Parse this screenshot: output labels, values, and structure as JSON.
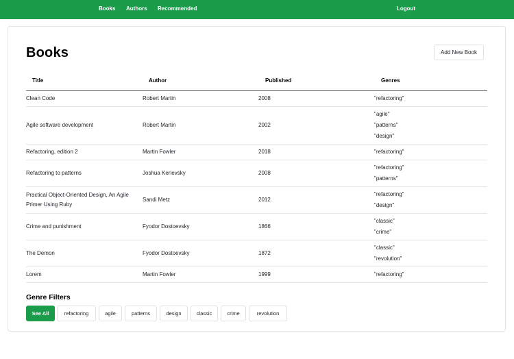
{
  "nav": {
    "books": "Books",
    "authors": "Authors",
    "recommended": "Recommended",
    "logout": "Logout"
  },
  "page": {
    "title": "Books",
    "add_button": "Add New Book"
  },
  "table": {
    "headers": {
      "title": "Title",
      "author": "Author",
      "published": "Published",
      "genres": "Genres"
    },
    "rows": [
      {
        "title": "Clean Code",
        "author": "Robert Martin",
        "published": "2008",
        "genres": [
          "\"refactoring\""
        ]
      },
      {
        "title": "Agile software development",
        "author": "Robert Martin",
        "published": "2002",
        "genres": [
          "\"agile\"",
          "\"patterns\"",
          "\"design\""
        ]
      },
      {
        "title": "Refactoring, edition 2",
        "author": "Martin Fowler",
        "published": "2018",
        "genres": [
          "\"refactoring\""
        ]
      },
      {
        "title": "Refactoring to patterns",
        "author": "Joshua Kerievsky",
        "published": "2008",
        "genres": [
          "\"refactoring\"",
          "\"patterns\""
        ]
      },
      {
        "title": "Practical Object-Oriented Design, An Agile Primer Using Ruby",
        "author": "Sandi Metz",
        "published": "2012",
        "genres": [
          "\"refactoring\"",
          "\"design\""
        ]
      },
      {
        "title": "Crime and punishment",
        "author": "Fyodor Dostoevsky",
        "published": "1866",
        "genres": [
          "\"classic\"",
          "\"crime\""
        ]
      },
      {
        "title": "The Demon",
        "author": "Fyodor Dostoevsky",
        "published": "1872",
        "genres": [
          "\"classic\"",
          "\"revolution\""
        ]
      },
      {
        "title": "Lorem",
        "author": "Martin Fowler",
        "published": "1999",
        "genres": [
          "\"refactoring\""
        ]
      }
    ]
  },
  "filters": {
    "title": "Genre Filters",
    "selected": "See All",
    "items": [
      "See All",
      "refactoring",
      "agile",
      "patterns",
      "design",
      "classic",
      "crime",
      "revolution"
    ]
  },
  "colors": {
    "brand": "#1a9c4a"
  }
}
